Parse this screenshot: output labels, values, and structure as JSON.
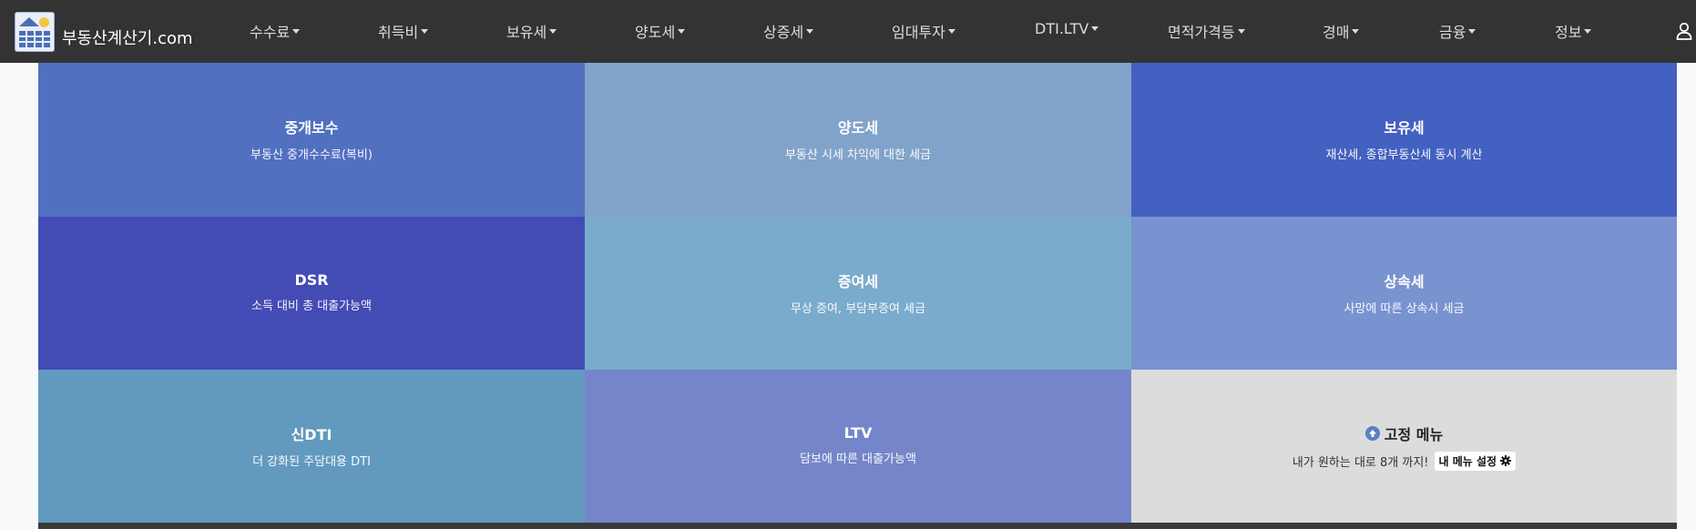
{
  "brand": {
    "name": "부동산계산기.com"
  },
  "nav": [
    {
      "label": "수수료"
    },
    {
      "label": "취득비"
    },
    {
      "label": "보유세"
    },
    {
      "label": "양도세"
    },
    {
      "label": "상증세"
    },
    {
      "label": "임대투자"
    },
    {
      "label": "DTI.LTV"
    },
    {
      "label": "면적가격등"
    },
    {
      "label": "경매"
    },
    {
      "label": "금융"
    },
    {
      "label": "정보"
    }
  ],
  "user_icon": "user-icon",
  "tiles": [
    {
      "title": "중개보수",
      "subtitle": "부동산 중개수수료(복비)",
      "color": "#5170c0"
    },
    {
      "title": "양도세",
      "subtitle": "부동산 시세 차익에 대한 세금",
      "color": "#82a3c9"
    },
    {
      "title": "보유세",
      "subtitle": "재산세, 종합부동산세 동시 계산",
      "color": "#4361c0"
    },
    {
      "title": "DSR",
      "subtitle": "소득 대비 총 대출가능액",
      "color": "#434bb5"
    },
    {
      "title": "증여세",
      "subtitle": "무상 증여, 부담부증여 세금",
      "color": "#7aabcc"
    },
    {
      "title": "상속세",
      "subtitle": "사망에 따른 상속시 세금",
      "color": "#7893cf"
    },
    {
      "title": "신DTI",
      "subtitle": "더 강화된 주담대용 DTI",
      "color": "#629abf"
    },
    {
      "title": "LTV",
      "subtitle": "담보에 따른 대출가능액",
      "color": "#7486c9"
    }
  ],
  "fixed_menu": {
    "title": "고정 메뉴",
    "subtitle": "내가 원하는 대로 8개 까지!",
    "button_label": "내 메뉴 설정",
    "icon": "arrow-up-circle-icon",
    "button_icon": "gear-icon",
    "color": "#dcdcdc"
  }
}
